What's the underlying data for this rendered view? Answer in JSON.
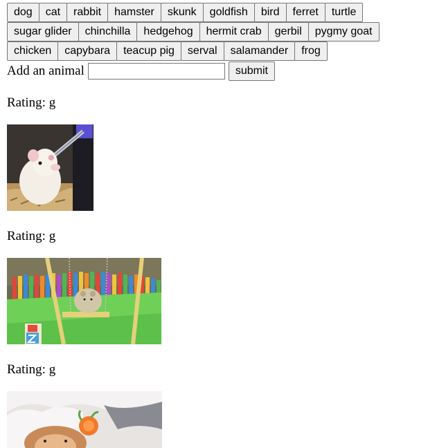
{
  "animals": [
    "dog",
    "cat",
    "rabbit",
    "hamster",
    "skunk",
    "goldfish",
    "bird",
    "ferret",
    "turtle",
    "sugar glider",
    "chinchilla",
    "hedgehog",
    "hermit crab",
    "gerbil",
    "pygmy goat",
    "chicken",
    "capybara",
    "teacup pig",
    "serval",
    "salamander",
    "frog"
  ],
  "add_form": {
    "label": "Add an animal",
    "input_value": "",
    "submit_label": "submit"
  },
  "gifs": [
    {
      "rating_label": "Rating: g"
    },
    {
      "rating_label": "Rating: g"
    },
    {
      "rating_label": "Rating: g"
    }
  ]
}
